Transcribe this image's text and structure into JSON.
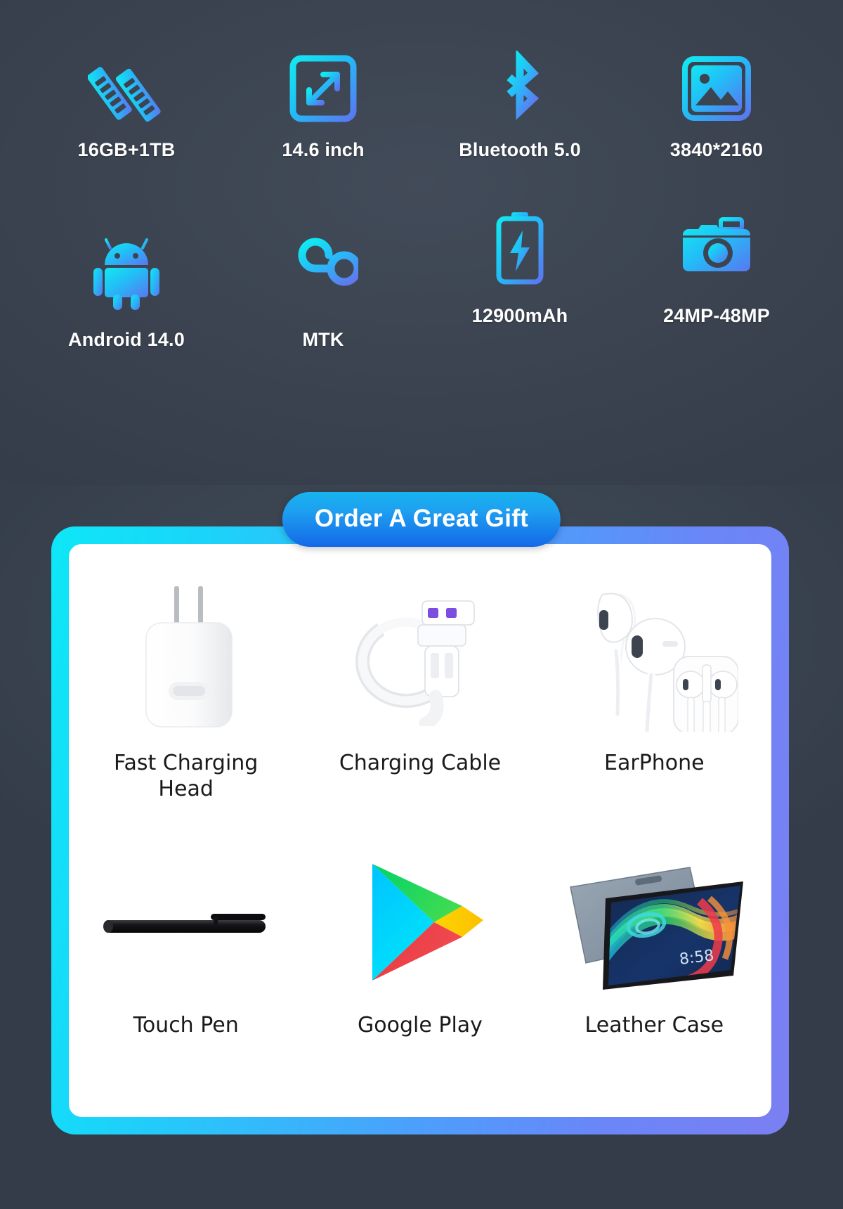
{
  "specs": {
    "rows": [
      [
        {
          "label": "16GB+1TB",
          "icon": "ram-memory-icon"
        },
        {
          "label": "14.6 inch",
          "icon": "screen-size-icon"
        },
        {
          "label": "Bluetooth 5.0",
          "icon": "bluetooth-icon"
        },
        {
          "label": "3840*2160",
          "icon": "image-resolution-icon"
        }
      ],
      [
        {
          "label": "Android 14.0",
          "icon": "android-icon"
        },
        {
          "label": "MTK",
          "icon": "mtk-chipset-icon"
        },
        {
          "label": "12900mAh",
          "icon": "battery-charging-icon"
        },
        {
          "label": "24MP-48MP",
          "icon": "camera-icon"
        }
      ]
    ]
  },
  "gift": {
    "badge": "Order A Great Gift",
    "rows": [
      [
        {
          "label_line1": "Fast Charging",
          "label_line2": "Head",
          "art": "charger-head-art"
        },
        {
          "label_line1": "Charging Cable",
          "label_line2": "",
          "art": "usb-cable-art"
        },
        {
          "label_line1": "EarPhone",
          "label_line2": "",
          "art": "earphone-art"
        }
      ],
      [
        {
          "label_line1": "Touch Pen",
          "label_line2": "",
          "art": "stylus-pen-art"
        },
        {
          "label_line1": "Google Play",
          "label_line2": "",
          "art": "google-play-art"
        },
        {
          "label_line1": "Leather Case",
          "label_line2": "",
          "art": "tablet-case-art"
        }
      ]
    ],
    "tablet_clock": "8:58"
  },
  "colors": {
    "background": "#3c4452",
    "icon_gradient_start": "#13e8f0",
    "icon_gradient_end": "#5a76f0",
    "badge_gradient_start": "#17b4ef",
    "badge_gradient_end": "#1469e8",
    "card_border_start": "#0ee7f7",
    "card_border_end": "#7b7ff2",
    "label_white": "#ffffff",
    "gift_label_dark": "#1a1a1a"
  }
}
